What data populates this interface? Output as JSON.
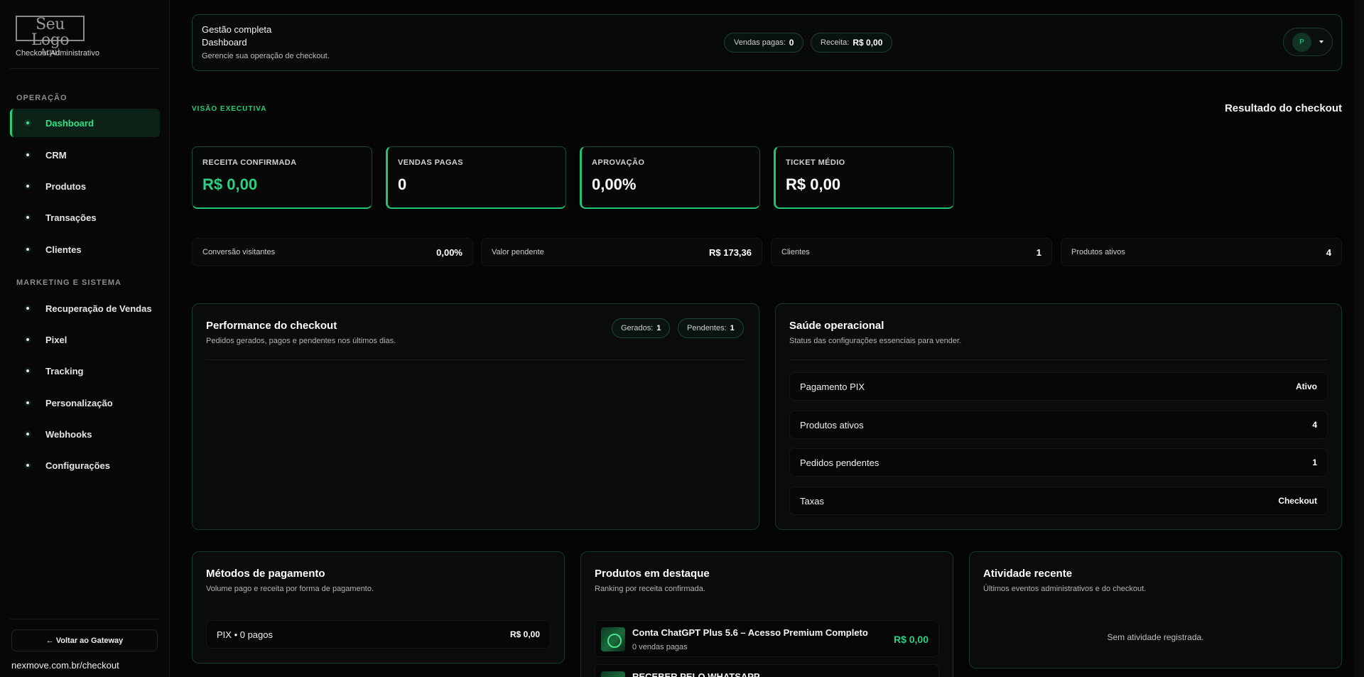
{
  "sidebar": {
    "logo_line1": "Seu Logo",
    "logo_line2": "Aqui",
    "subtitle": "Checkout Administrativo",
    "section1": "OPERAÇÃO",
    "section2": "MARKETING E SISTEMA",
    "items": [
      {
        "label": "Dashboard"
      },
      {
        "label": "CRM"
      },
      {
        "label": "Produtos"
      },
      {
        "label": "Transações"
      },
      {
        "label": "Clientes"
      },
      {
        "label": "Recuperação de Vendas"
      },
      {
        "label": "Pixel"
      },
      {
        "label": "Tracking"
      },
      {
        "label": "Personalização"
      },
      {
        "label": "Webhooks"
      },
      {
        "label": "Configurações"
      }
    ],
    "back_label": "← Voltar ao Gateway",
    "domain": "nexmove.com.br/checkout"
  },
  "header": {
    "title1": "Gestão completa",
    "title2": "Dashboard",
    "subtitle": "Gerencie sua operação de checkout.",
    "paid_label": "Vendas pagas:",
    "paid_value": "0",
    "revenue_label": "Receita:",
    "revenue_value": "R$ 0,00",
    "avatar_letter": "P"
  },
  "exec": {
    "eyebrow": "VISÃO EXECUTIVA",
    "result_title": "Resultado do checkout"
  },
  "kpis": [
    {
      "label": "RECEITA CONFIRMADA",
      "value": "R$ 0,00"
    },
    {
      "label": "VENDAS PAGAS",
      "value": "0"
    },
    {
      "label": "APROVAÇÃO",
      "value": "0,00%"
    },
    {
      "label": "TICKET MÉDIO",
      "value": "R$ 0,00"
    }
  ],
  "metrics": [
    {
      "label": "Conversão visitantes",
      "value": "0,00%"
    },
    {
      "label": "Valor pendente",
      "value": "R$ 173,36"
    },
    {
      "label": "Clientes",
      "value": "1"
    },
    {
      "label": "Produtos ativos",
      "value": "4"
    }
  ],
  "performance": {
    "title": "Performance do checkout",
    "subtitle": "Pedidos gerados, pagos e pendentes nos últimos dias.",
    "generated_label": "Gerados:",
    "generated_value": "1",
    "pending_label": "Pendentes:",
    "pending_value": "1"
  },
  "health": {
    "title": "Saúde operacional",
    "subtitle": "Status das configurações essenciais para vender.",
    "rows": [
      {
        "label": "Pagamento PIX",
        "value": "Ativo"
      },
      {
        "label": "Produtos ativos",
        "value": "4"
      },
      {
        "label": "Pedidos pendentes",
        "value": "1"
      },
      {
        "label": "Taxas",
        "value": "Checkout"
      }
    ]
  },
  "payments": {
    "title": "Métodos de pagamento",
    "subtitle": "Volume pago e receita por forma de pagamento.",
    "rows": [
      {
        "label": "PIX • 0 pagos",
        "value": "R$ 0,00"
      }
    ]
  },
  "products": {
    "title": "Produtos em destaque",
    "subtitle": "Ranking por receita confirmada.",
    "items": [
      {
        "name": "Conta ChatGPT Plus 5.6 – Acesso Premium Completo",
        "sales": "0 vendas pagas",
        "price": "R$ 0,00"
      },
      {
        "name": "RECEBER PELO WHATSAPP",
        "sales": "",
        "price": ""
      }
    ]
  },
  "activity": {
    "title": "Atividade recente",
    "subtitle": "Últimos eventos administrativos e do checkout.",
    "empty": "Sem atividade registrada."
  }
}
